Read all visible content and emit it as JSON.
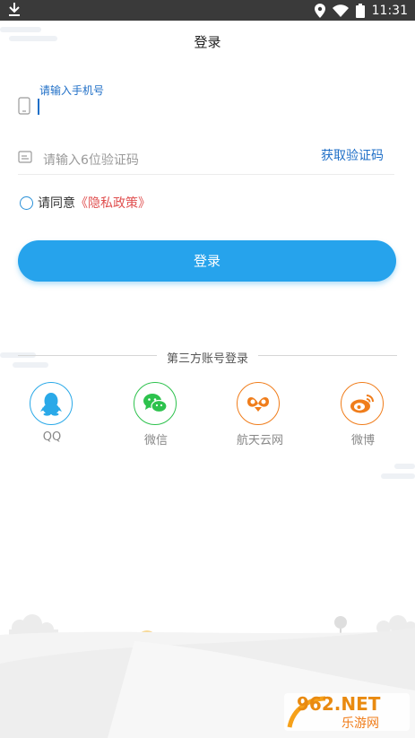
{
  "status_bar": {
    "time": "11:31"
  },
  "header": {
    "title": "登录"
  },
  "phone_field": {
    "floating_label": "请输入手机号",
    "value": ""
  },
  "code_field": {
    "placeholder": "请输入6位验证码",
    "get_code_label": "获取验证码"
  },
  "agreement": {
    "text": "请同意",
    "policy_link": "《隐私政策》"
  },
  "login_button": {
    "label": "登录"
  },
  "third_party": {
    "title": "第三方账号登录",
    "providers": [
      {
        "label": "QQ",
        "icon": "qq-icon",
        "color": "#2aa9e8"
      },
      {
        "label": "微信",
        "icon": "wechat-icon",
        "color": "#2dc24d"
      },
      {
        "label": "航天云网",
        "icon": "casic-cloud-icon",
        "color": "#f07d1b"
      },
      {
        "label": "微博",
        "icon": "weibo-icon",
        "color": "#f07d1b"
      }
    ]
  },
  "watermark": {
    "brand": "962.NET",
    "sub": "乐游网"
  },
  "colors": {
    "accent": "#26a3ec",
    "link_blue": "#1f6fc7",
    "policy_red": "#e05050"
  }
}
